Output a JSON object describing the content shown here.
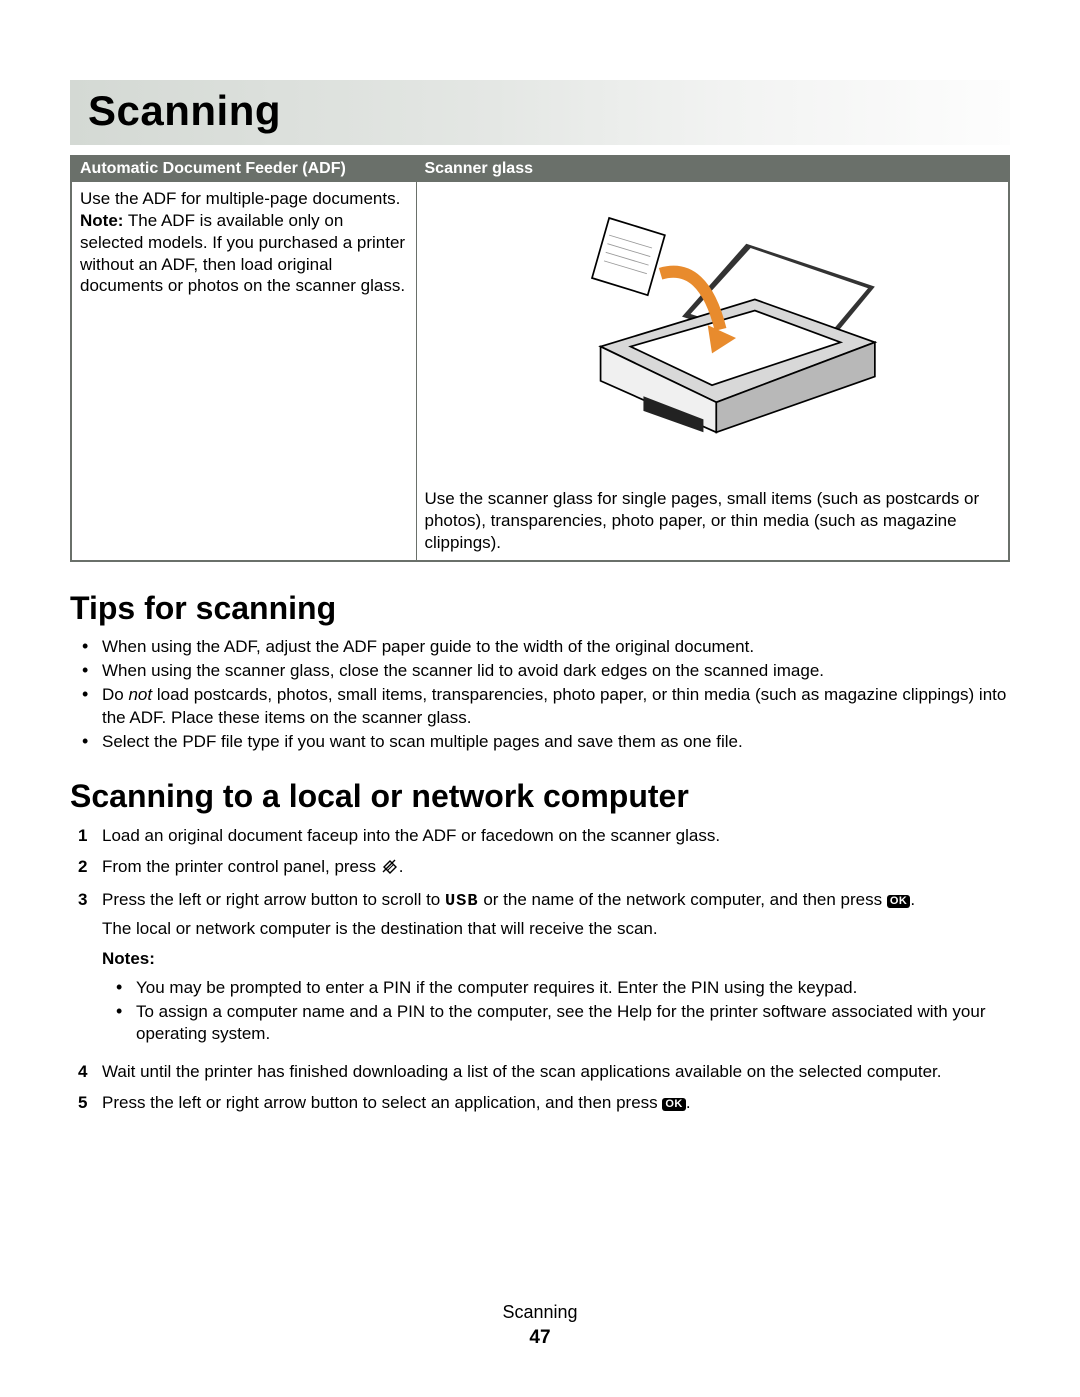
{
  "chapter_title": "Scanning",
  "table": {
    "headers": {
      "adf": "Automatic Document Feeder (ADF)",
      "glass": "Scanner glass"
    },
    "adf": {
      "line1": "Use the ADF for multiple-page documents.",
      "note_label": "Note:",
      "note_body": " The ADF is available only on selected models. If you purchased a printer without an ADF, then load original documents or photos on the scanner glass."
    },
    "glass": {
      "caption": "Use the scanner glass for single pages, small items (such as postcards or photos), transparencies, photo paper, or thin media (such as magazine clippings)."
    }
  },
  "tips_heading": "Tips for scanning",
  "tips": [
    {
      "pre": "When using the ADF, adjust the ADF paper guide to the width of the original document."
    },
    {
      "pre": "When using the scanner glass, close the scanner lid to avoid dark edges on the scanned image."
    },
    {
      "pre": "Do ",
      "em": "not",
      "post": " load postcards, photos, small items, transparencies, photo paper, or thin media (such as magazine clippings) into the ADF. Place these items on the scanner glass."
    },
    {
      "pre": "Select the PDF file type if you want to scan multiple pages and save them as one file."
    }
  ],
  "scan_to_heading": "Scanning to a local or network computer",
  "steps": {
    "s1": "Load an original document faceup into the ADF or facedown on the scanner glass.",
    "s2": "From the printer control panel, press ",
    "s3a": "Press the left or right arrow button to scroll to ",
    "s3_usb": "USB",
    "s3b": " or the name of the network computer, and then press ",
    "s3_sub": "The local or network computer is the destination that will receive the scan.",
    "notes_label": "Notes:",
    "note1": "You may be prompted to enter a PIN if the computer requires it. Enter the PIN using the keypad.",
    "note2": "To assign a computer name and a PIN to the computer, see the Help for the printer software associated with your operating system.",
    "s4": "Wait until the printer has finished downloading a list of the scan applications available on the selected computer.",
    "s5a": "Press the left or right arrow button to select an application, and then press "
  },
  "ok_label": "OK",
  "footer": {
    "section": "Scanning",
    "page": "47"
  }
}
